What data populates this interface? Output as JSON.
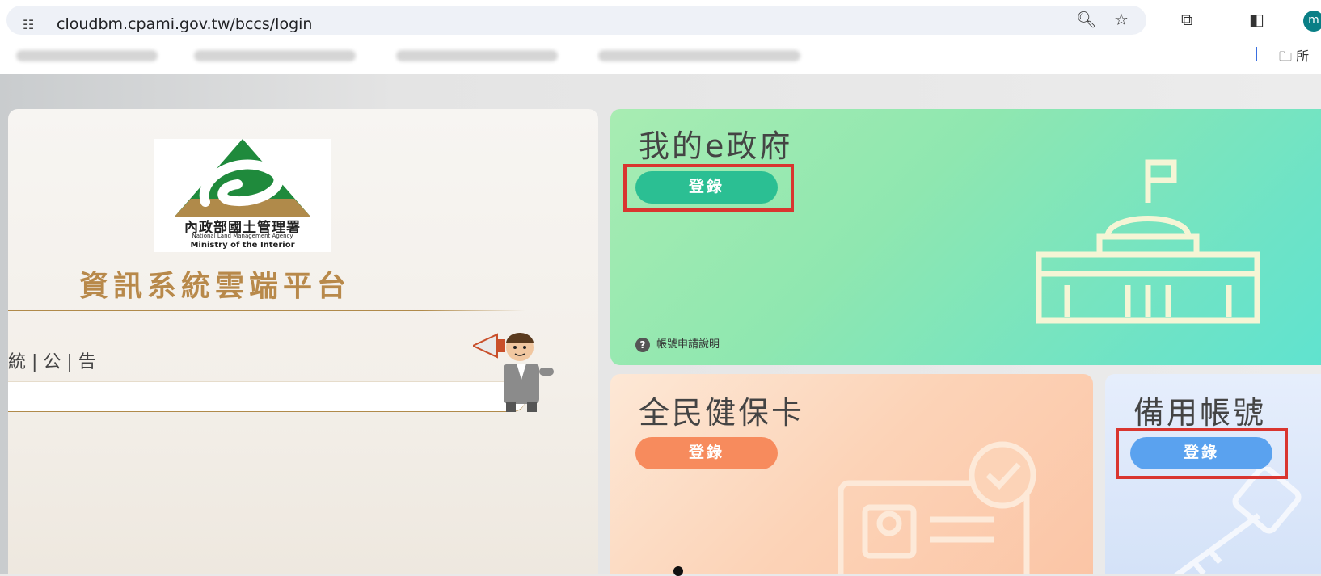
{
  "browser": {
    "url": "cloudbm.cpami.gov.tw/bccs/login",
    "site_info_icon": "site-settings-icon",
    "avatar_letter": "m",
    "bookmark_folder_label": "所"
  },
  "logo": {
    "agency_cn": "內政部國土管理署",
    "agency_en": "National Land Management Agency",
    "ministry_en": "Ministry of the Interior"
  },
  "platform_title": "資訊系統雲端平台",
  "notice_label": "統 | 公 | 告",
  "cards": {
    "egov": {
      "title": "我的e政府",
      "login_label": "登錄",
      "help_text": "帳號申請說明",
      "color": "#2bbf93"
    },
    "nhi": {
      "title": "全民健保卡",
      "login_label": "登錄",
      "color": "#f78b5d"
    },
    "backup": {
      "title": "備用帳號",
      "login_label": "登錄",
      "color": "#5aa2ef"
    }
  },
  "highlight_color": "#d9352f"
}
